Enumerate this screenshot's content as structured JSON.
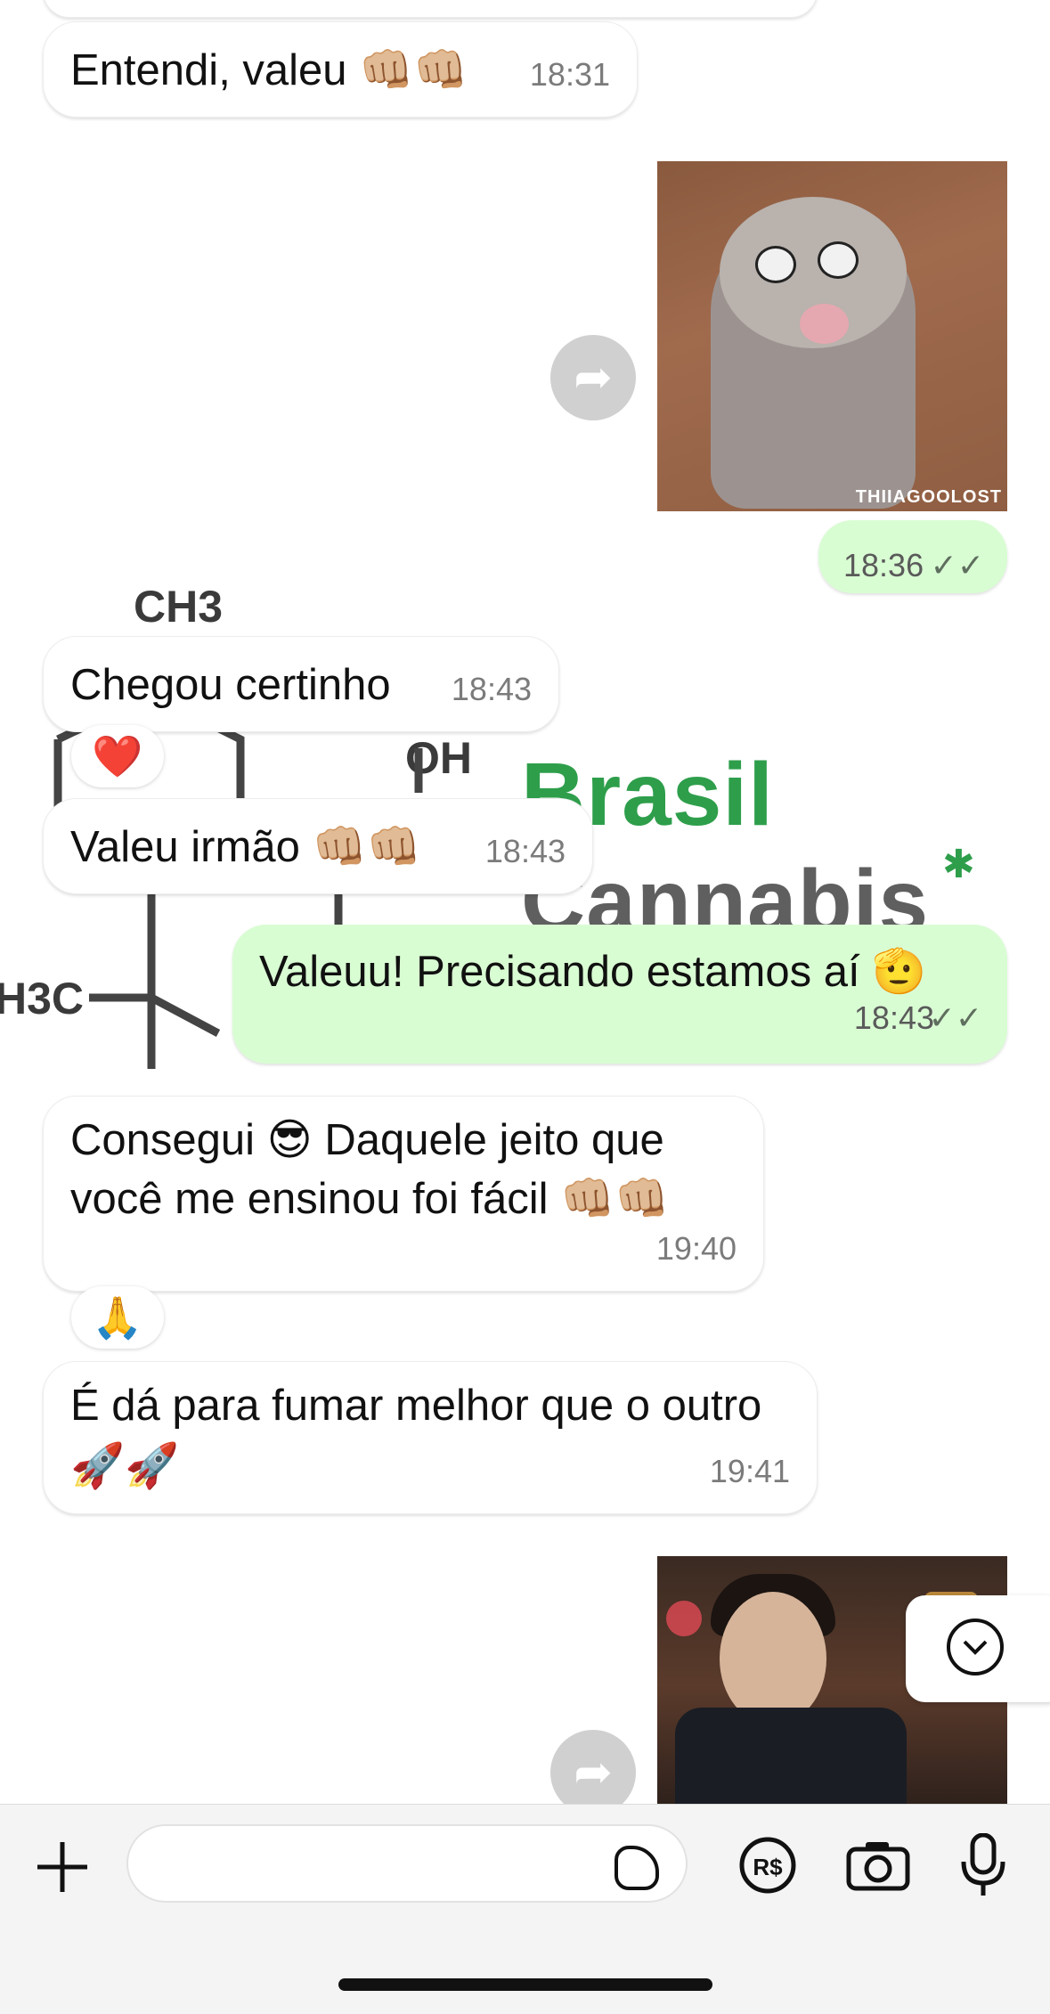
{
  "colors": {
    "outgoing_bubble": "#d9fdd3",
    "incoming_bubble": "#ffffff",
    "brand_green": "#2e9e4b"
  },
  "wallpaper": {
    "brand_line1": "Brasil",
    "brand_line2": "Cannabis",
    "ch3": "CH3",
    "oh": "OH",
    "h3c": "H3C"
  },
  "messages": [
    {
      "dir": "in",
      "text": "Entendi, valeu 👊🏼👊🏼",
      "time": "18:31"
    },
    {
      "dir": "out",
      "type": "image",
      "description_icon": "gif-opossum",
      "watermark": "THIIAGOOLOST"
    },
    {
      "dir": "out",
      "type": "time-only",
      "time": "18:36",
      "status": "read"
    },
    {
      "dir": "in",
      "text": "Chegou certinho",
      "time": "18:43",
      "reaction": "❤️"
    },
    {
      "dir": "in",
      "text": "Valeu irmão 👊🏼👊🏼",
      "time": "18:43"
    },
    {
      "dir": "out",
      "text": "Valeuu! Precisando estamos aí 🫡",
      "time": "18:43",
      "status": "read"
    },
    {
      "dir": "in",
      "text_line1": "Consegui 😎 Daquele jeito que",
      "text_line2": "você me ensinou foi fácil 👊🏼👊🏼",
      "time": "19:40",
      "reaction": "🙏"
    },
    {
      "dir": "in",
      "text_line1": "É dá para fumar melhor que o outro",
      "text_line2": "🚀🚀",
      "time": "19:41"
    },
    {
      "dir": "out",
      "type": "image",
      "description_icon": "gif-man-toast"
    }
  ],
  "composer": {
    "placeholder": "",
    "value": ""
  },
  "icons": {
    "read_ticks": "✓✓",
    "forward": "➦",
    "scroll_down": "chevron-down"
  }
}
